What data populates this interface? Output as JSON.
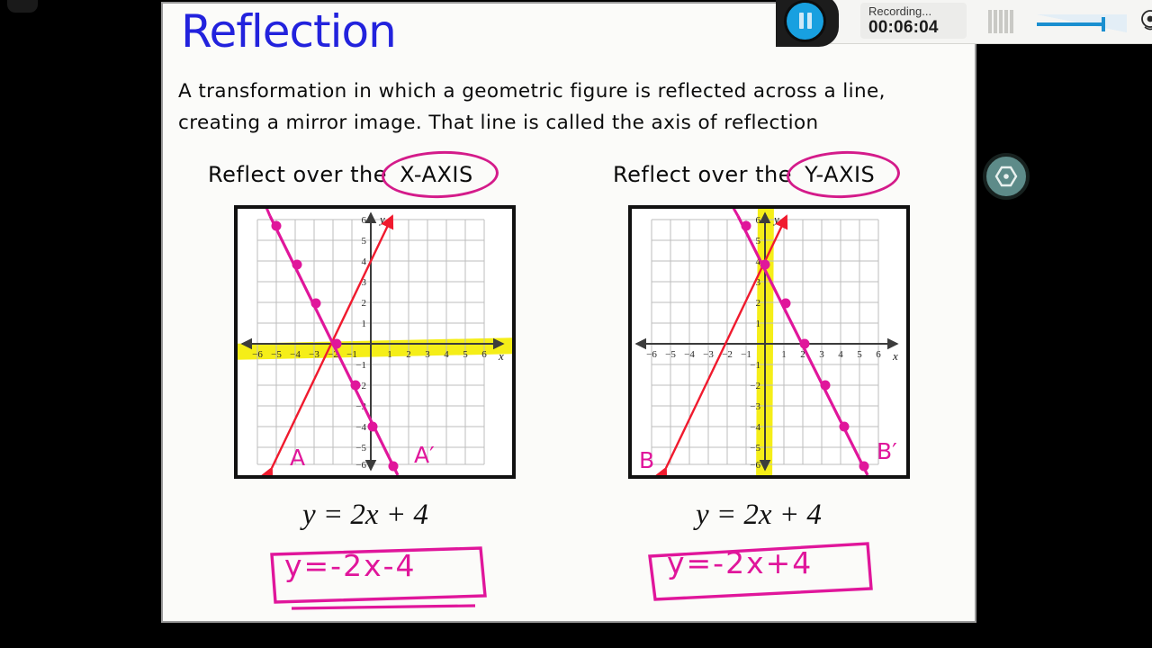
{
  "slide": {
    "title": "Reflection",
    "definition": "A transformation in which a geometric figure is reflected across a line, creating a mirror image. That line is called the axis of reflection",
    "left_panel": {
      "heading_prefix": "Reflect over the",
      "heading_circled": "X-AXIS",
      "original_equation": "y = 2x + 4",
      "image_equation": "y=-2x-4",
      "original_label": "A",
      "image_label": "A'",
      "axis_of_reflection": "x-axis",
      "highlight_color": "#f5ee18"
    },
    "right_panel": {
      "heading_prefix": "Reflect over the",
      "heading_circled": "Y-AXIS",
      "original_equation": "y = 2x + 4",
      "image_equation": "y=-2x+4",
      "original_label": "B",
      "image_label": "B'",
      "axis_of_reflection": "y-axis",
      "highlight_color": "#f5ee18"
    },
    "colors": {
      "title": "#2222dd",
      "ink_pink": "#d41b8a",
      "line_original": "#f01a2e",
      "line_image": "#e0169b",
      "grid": "#b9b9b9",
      "axis": "#4a4a4a"
    }
  },
  "chart_data": [
    {
      "type": "line",
      "title": "Reflect over the X-AXIS",
      "xlabel": "x",
      "ylabel": "y",
      "xlim": [
        -6.8,
        6.8
      ],
      "ylim": [
        -6.8,
        6.8
      ],
      "xticks": [
        -6,
        -5,
        -4,
        -3,
        -2,
        -1,
        1,
        2,
        3,
        4,
        5,
        6
      ],
      "yticks": [
        -6,
        -5,
        -4,
        -3,
        -2,
        -1,
        1,
        2,
        3,
        4,
        5,
        6
      ],
      "grid": true,
      "legend": "none",
      "series": [
        {
          "name": "A",
          "equation": "y = 2x + 4",
          "color": "#f01a2e",
          "slope": 2,
          "intercept": 4,
          "x": [
            -5,
            1
          ],
          "y": [
            -6,
            6
          ],
          "points": []
        },
        {
          "name": "A'",
          "equation": "y = -2x - 4",
          "color": "#e0169b",
          "slope": -2,
          "intercept": -4,
          "x": [
            -5,
            1
          ],
          "y": [
            6,
            -6
          ],
          "points": [
            {
              "x": -5,
              "y": 6
            },
            {
              "x": -4,
              "y": 4
            },
            {
              "x": -3,
              "y": 2
            },
            {
              "x": -2,
              "y": 0
            },
            {
              "x": -1,
              "y": -2
            },
            {
              "x": 0,
              "y": -4
            },
            {
              "x": 1,
              "y": -6
            }
          ]
        }
      ],
      "annotations": [
        {
          "text": "A",
          "x": -4.3,
          "y": -5.6,
          "color": "#e0169b"
        },
        {
          "text": "A'",
          "x": 1.6,
          "y": -5.5,
          "color": "#e0169b"
        },
        {
          "text": "x-axis highlighted",
          "color": "#f5ee18"
        }
      ]
    },
    {
      "type": "line",
      "title": "Reflect over the Y-AXIS",
      "xlabel": "x",
      "ylabel": "y",
      "xlim": [
        -6.8,
        6.8
      ],
      "ylim": [
        -6.8,
        6.8
      ],
      "xticks": [
        -6,
        -5,
        -4,
        -3,
        -2,
        -1,
        1,
        2,
        3,
        4,
        5,
        6
      ],
      "yticks": [
        -6,
        -5,
        -4,
        -3,
        -2,
        -1,
        1,
        2,
        3,
        4,
        5,
        6
      ],
      "grid": true,
      "legend": "none",
      "series": [
        {
          "name": "B",
          "equation": "y = 2x + 4",
          "color": "#f01a2e",
          "slope": 2,
          "intercept": 4,
          "x": [
            -5,
            1
          ],
          "y": [
            -6,
            6
          ],
          "points": []
        },
        {
          "name": "B'",
          "equation": "y = -2x + 4",
          "color": "#e0169b",
          "slope": -2,
          "intercept": 4,
          "x": [
            -1,
            5
          ],
          "y": [
            6,
            -6
          ],
          "points": [
            {
              "x": -1,
              "y": 6
            },
            {
              "x": 0,
              "y": 4
            },
            {
              "x": 1,
              "y": 2
            },
            {
              "x": 2,
              "y": 0
            },
            {
              "x": 3,
              "y": -2
            },
            {
              "x": 4,
              "y": -4
            },
            {
              "x": 5,
              "y": -6
            }
          ]
        }
      ],
      "annotations": [
        {
          "text": "B",
          "x": -5.9,
          "y": -5.7,
          "color": "#e0169b"
        },
        {
          "text": "B'",
          "x": 5.9,
          "y": -5.3,
          "color": "#e0169b"
        },
        {
          "text": "y-axis highlighted",
          "color": "#f5ee18"
        }
      ]
    }
  ],
  "recorder": {
    "status_label": "Recording...",
    "timer": "00:06:04",
    "pause_icon": "pause-icon",
    "levels_icon": "audio-levels-icon",
    "volume_icon": "volume-slider",
    "webcam_icon": "webcam-add-icon",
    "pen_icon": "pencil-annotate-icon"
  },
  "float_button": {
    "icon": "hexagon-record-icon"
  }
}
